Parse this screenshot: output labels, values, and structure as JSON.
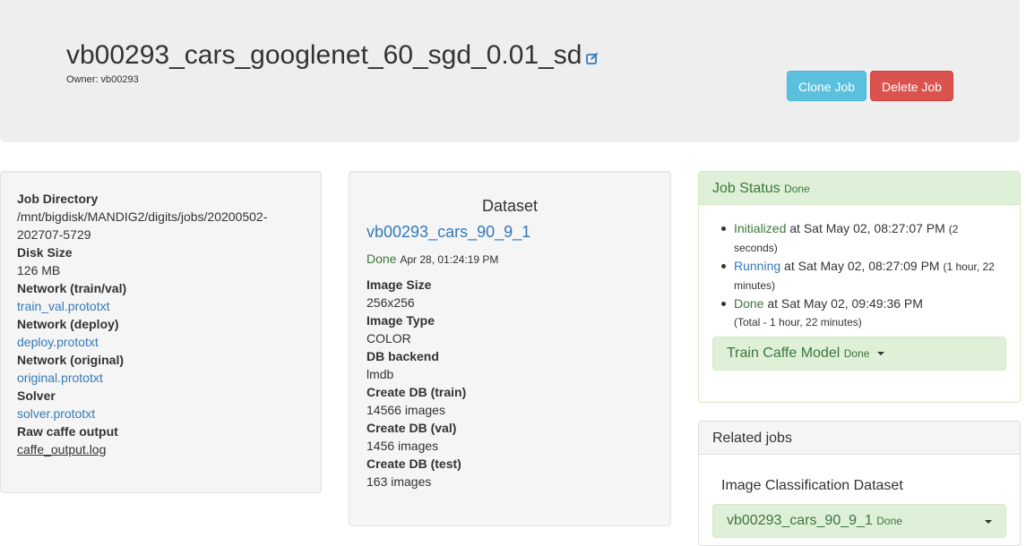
{
  "header": {
    "job_name": "vb00293_cars_googlenet_60_sgd_0.01_sd",
    "owner": "Owner: vb00293",
    "clone_button": "Clone Job",
    "delete_button": "Delete Job",
    "colors": {
      "clone": "#5bc0de",
      "delete": "#d9534f",
      "link": "#337ab7"
    }
  },
  "job_info": {
    "job_directory_label": "Job Directory",
    "job_directory_value": "/mnt/bigdisk/MANDIG2/digits/jobs/20200502-202707-5729",
    "disk_size_label": "Disk Size",
    "disk_size_value": "126 MB",
    "network_train_val_label": "Network (train/val)",
    "network_train_val_link": "train_val.prototxt",
    "network_deploy_label": "Network (deploy)",
    "network_deploy_link": "deploy.prototxt",
    "network_original_label": "Network (original)",
    "network_original_link": "original.prototxt",
    "solver_label": "Solver",
    "solver_link": "solver.prototxt",
    "raw_output_label": "Raw caffe output",
    "raw_output_link": "caffe_output.log"
  },
  "dataset": {
    "title": "Dataset",
    "name": "vb00293_cars_90_9_1",
    "status": "Done",
    "status_time": "Apr 28, 01:24:19 PM",
    "image_size_label": "Image Size",
    "image_size_value": "256x256",
    "image_type_label": "Image Type",
    "image_type_value": "COLOR",
    "db_backend_label": "DB backend",
    "db_backend_value": "lmdb",
    "create_train_label": "Create DB (train)",
    "create_train_value": "14566 images",
    "create_val_label": "Create DB (val)",
    "create_val_value": "1456 images",
    "create_test_label": "Create DB (test)",
    "create_test_value": "163 images"
  },
  "job_status": {
    "heading": "Job Status",
    "heading_state": "Done",
    "events": [
      {
        "name": "Initialized",
        "time": "at Sat May 02, 08:27:07 PM",
        "duration": "(2 seconds)"
      },
      {
        "name": "Running",
        "time": "at Sat May 02, 08:27:09 PM",
        "duration": "(1 hour, 22 minutes)"
      },
      {
        "name": "Done",
        "time": "at Sat May 02, 09:49:36 PM",
        "duration": "(Total - 1 hour, 22 minutes)"
      }
    ],
    "task_label": "Train Caffe Model",
    "task_state": "Done"
  },
  "related": {
    "heading": "Related jobs",
    "dataset_type": "Image Classification Dataset",
    "dataset_name": "vb00293_cars_90_9_1",
    "dataset_state": "Done"
  }
}
